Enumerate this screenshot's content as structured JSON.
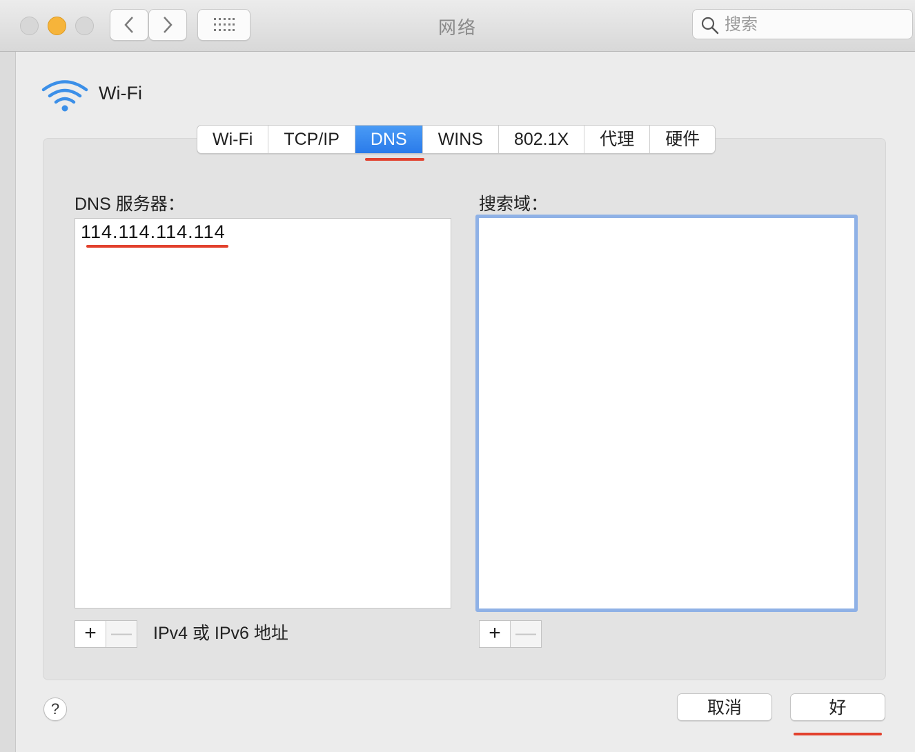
{
  "window": {
    "title": "网络"
  },
  "search": {
    "placeholder": "搜索"
  },
  "interface": {
    "name": "Wi-Fi"
  },
  "tabs": [
    {
      "label": "Wi-Fi",
      "active": false
    },
    {
      "label": "TCP/IP",
      "active": false
    },
    {
      "label": "DNS",
      "active": true
    },
    {
      "label": "WINS",
      "active": false
    },
    {
      "label": "802.1X",
      "active": false
    },
    {
      "label": "代理",
      "active": false
    },
    {
      "label": "硬件",
      "active": false
    }
  ],
  "dns": {
    "servers_label": "DNS 服务器：",
    "servers": [
      "114.114.114.114"
    ],
    "search_domains_label": "搜索域：",
    "search_domains": [],
    "add_symbol": "+",
    "remove_symbol": "—",
    "hint": "IPv4 或 IPv6 地址"
  },
  "footer": {
    "help_symbol": "?",
    "cancel_label": "取消",
    "ok_label": "好"
  },
  "colors": {
    "accent": "#2a7bea",
    "annotation_red": "#e2412d",
    "focus_ring": "#8fb1e6"
  }
}
